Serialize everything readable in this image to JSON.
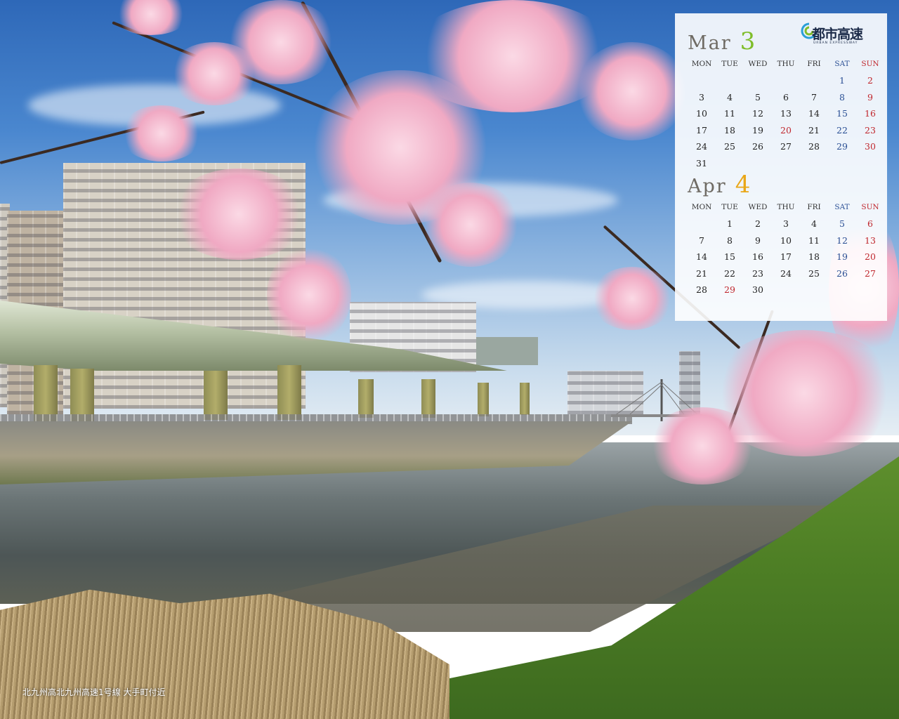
{
  "calendar": {
    "march": {
      "name": "Mar",
      "number": "3",
      "headers": [
        "MON",
        "TUE",
        "WED",
        "THU",
        "FRI",
        "SAT",
        "SUN"
      ],
      "weeks": [
        [
          "",
          "",
          "",
          "",
          "",
          "1",
          "2"
        ],
        [
          "3",
          "4",
          "5",
          "6",
          "7",
          "8",
          "9"
        ],
        [
          "10",
          "11",
          "12",
          "13",
          "14",
          "15",
          "16"
        ],
        [
          "17",
          "18",
          "19",
          "20",
          "21",
          "22",
          "23"
        ],
        [
          "24",
          "25",
          "26",
          "27",
          "28",
          "29",
          "30"
        ],
        [
          "31",
          "",
          "",
          "",
          "",
          "",
          ""
        ]
      ],
      "holidays": [
        "20"
      ]
    },
    "april": {
      "name": "Apr",
      "number": "4",
      "headers": [
        "MON",
        "TUE",
        "WED",
        "THU",
        "FRI",
        "SAT",
        "SUN"
      ],
      "weeks": [
        [
          "",
          "1",
          "2",
          "3",
          "4",
          "5",
          "6"
        ],
        [
          "7",
          "8",
          "9",
          "10",
          "11",
          "12",
          "13"
        ],
        [
          "14",
          "15",
          "16",
          "17",
          "18",
          "19",
          "20"
        ],
        [
          "21",
          "22",
          "23",
          "24",
          "25",
          "26",
          "27"
        ],
        [
          "28",
          "29",
          "30",
          "",
          "",
          "",
          ""
        ]
      ],
      "holidays": [
        "29"
      ]
    },
    "colors": {
      "march_number": "#7fbd2a",
      "april_number": "#e9a718",
      "saturday": "#2a4f94",
      "sunday": "#c0272d"
    }
  },
  "logo": {
    "text": "都市高速",
    "subtext": "URBAN EXPRESSWAY",
    "icon": "expressway-logo-icon"
  },
  "caption": "北九州高北九州高速1号線 大手町付近"
}
